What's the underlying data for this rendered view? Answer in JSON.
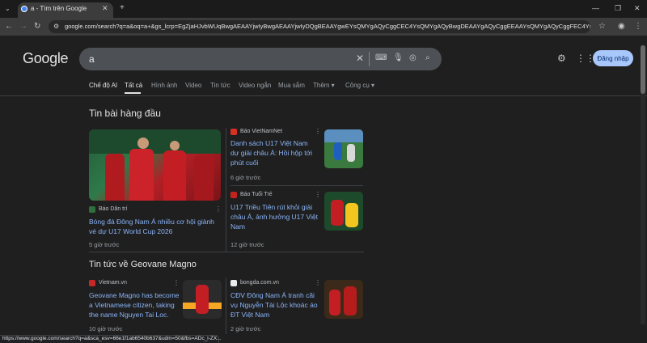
{
  "browser": {
    "tab_title": "a - Tìm trên Google",
    "new_tab": "+",
    "url": "google.com/search?q=a&oq=a+&gs_lcrp=EgZjaHJvbWUqBwgAEAAYjwIyBwgAEAAYjwIyDQgBEAAYgwEYsQMYgAQyCggCEC4YsQMYgAQyBwgDEAAYgAQyCggEEAAYsQMYgAQyCggFEC4YsQMYgAQyBg..."
  },
  "search": {
    "logo": "Google",
    "query": "a",
    "signin_label": "Đăng nhập"
  },
  "nav": {
    "items": [
      "Chế độ AI",
      "Tất cả",
      "Hình ảnh",
      "Video",
      "Tin tức",
      "Video ngắn",
      "Mua sắm",
      "Thêm",
      "Công cụ"
    ]
  },
  "top_stories": {
    "title": "Tin bài hàng đầu",
    "main": {
      "source": "Báo Dân trí",
      "headline": "Bóng đá Đông Nam Á nhiều cơ hội giành vé dự U17 World Cup 2026",
      "time": "5 giờ trước"
    },
    "side": [
      {
        "source": "Báo VietNamNet",
        "headline": "Danh sách U17 Việt Nam dự giải châu Á: Hồi hộp tới phút cuối",
        "time": "6 giờ trước"
      },
      {
        "source": "Báo Tuổi Trẻ",
        "headline": "U17 Triều Tiên rút khỏi giải châu Á, ảnh hưởng U17 Việt Nam",
        "time": "12 giờ trước"
      }
    ]
  },
  "geovane": {
    "title": "Tin tức về Geovane Magno",
    "items": [
      {
        "source": "Vietnam.vn",
        "headline": "Geovane Magno has become a Vietnamese citizen, taking the name Nguyen Tai Loc.",
        "time": "10 giờ trước"
      },
      {
        "source": "bongda.com.vn",
        "headline": "CĐV Đông Nam Á tranh cãi vụ Nguyễn Tài Lộc khoác áo ĐT Việt Nam",
        "time": "2 giờ trước"
      }
    ]
  },
  "status_url": "https://www.google.com/search?q=a&sca_esv=66e1f1ab6540b637&udm=50&fbs=ADc_l-ZX...",
  "colors": {
    "link": "#8ab4f8",
    "background": "#1f1f1f",
    "signin_bg": "#a8c7fa"
  }
}
